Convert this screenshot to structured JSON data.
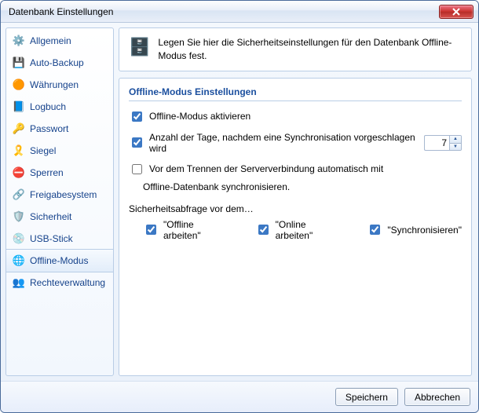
{
  "window": {
    "title": "Datenbank Einstellungen"
  },
  "sidebar": {
    "items": [
      {
        "label": "Allgemein",
        "icon": "⚙️",
        "icon_name": "gear-icon"
      },
      {
        "label": "Auto-Backup",
        "icon": "💾",
        "icon_name": "save-icon"
      },
      {
        "label": "Währungen",
        "icon": "🟠",
        "icon_name": "currency-icon"
      },
      {
        "label": "Logbuch",
        "icon": "📘",
        "icon_name": "logbook-icon"
      },
      {
        "label": "Passwort",
        "icon": "🔑",
        "icon_name": "key-icon"
      },
      {
        "label": "Siegel",
        "icon": "🎗️",
        "icon_name": "seal-icon"
      },
      {
        "label": "Sperren",
        "icon": "⛔",
        "icon_name": "block-icon"
      },
      {
        "label": "Freigabesystem",
        "icon": "🔗",
        "icon_name": "share-icon"
      },
      {
        "label": "Sicherheit",
        "icon": "🛡️",
        "icon_name": "shield-icon"
      },
      {
        "label": "USB-Stick",
        "icon": "💿",
        "icon_name": "usb-icon"
      },
      {
        "label": "Offline-Modus",
        "icon": "🌐",
        "icon_name": "offline-icon",
        "selected": true
      },
      {
        "label": "Rechteverwaltung",
        "icon": "👥",
        "icon_name": "users-icon"
      }
    ]
  },
  "info": {
    "text": "Legen Sie hier die Sicherheitseinstellungen für den Datenbank Offline-Modus fest."
  },
  "settings": {
    "section_title": "Offline-Modus Einstellungen",
    "enable_label": "Offline-Modus aktivieren",
    "enable_checked": true,
    "days_label": "Anzahl der Tage, nachdem eine Synchronisation vorgeschlagen wird",
    "days_checked": true,
    "days_value": "7",
    "autosync_label": "Vor dem Trennen der Serververbindung automatisch mit",
    "autosync_sub": "Offline-Datenbank synchronisieren.",
    "autosync_checked": false,
    "prompt_title": "Sicherheitsabfrage vor dem…",
    "prompts": [
      {
        "label": "\"Offline arbeiten\"",
        "checked": true
      },
      {
        "label": "\"Online arbeiten\"",
        "checked": true
      },
      {
        "label": "\"Synchronisieren\"",
        "checked": true
      }
    ]
  },
  "buttons": {
    "save": "Speichern",
    "cancel": "Abbrechen"
  }
}
